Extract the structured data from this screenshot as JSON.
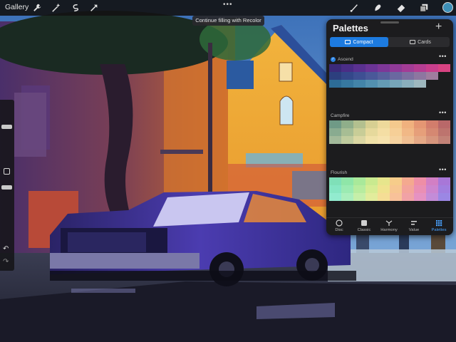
{
  "topbar": {
    "gallery_label": "Gallery",
    "more_label": "•••",
    "icons": [
      "wrench-icon",
      "magic-wand-icon",
      "selection-icon",
      "transform-arrow-icon",
      "brush-icon",
      "smudge-icon",
      "eraser-icon",
      "layers-icon"
    ],
    "current_color": "#3d8fb7"
  },
  "toast": {
    "text": "Continue filling with Recolor"
  },
  "sidebar": {
    "undo_label": "↶",
    "redo_label": "↷"
  },
  "palettes": {
    "title": "Palettes",
    "add_label": "+",
    "view_modes": [
      {
        "label": "Compact",
        "active": true
      },
      {
        "label": "Cards",
        "active": false
      }
    ],
    "items": [
      {
        "name": "Ascend",
        "default": true,
        "more": "•••",
        "colors": [
          "#3b2a7a",
          "#4a2d86",
          "#5a3190",
          "#6b3496",
          "#7d3798",
          "#903a98",
          "#a33c96",
          "#b53d92",
          "#c83e8c",
          "#d84382",
          "#2c3f7e",
          "#34478a",
          "#3e4f93",
          "#4a5899",
          "#58609d",
          "#6a68a0",
          "#7c6fa1",
          "#8d76a0",
          "#9f7d9e",
          "#1c1c1e",
          "#2d6c97",
          "#3778a0",
          "#4384a9",
          "#5290b0",
          "#649bb5",
          "#77a5b9",
          "#8aaebc",
          "#9eb7be",
          "#1c1c1e",
          "#1c1c1e"
        ]
      },
      {
        "name": "Campfire",
        "default": false,
        "more": "•••",
        "colors": [
          "#6f9a86",
          "#8fae8a",
          "#b3c08f",
          "#d7cf92",
          "#edd99b",
          "#f4c98d",
          "#f0b17e",
          "#e49673",
          "#d27d6c",
          "#b96869",
          "#89ab90",
          "#a7bd94",
          "#c8cd97",
          "#e6d99c",
          "#f4dea4",
          "#f6cf97",
          "#f1b886",
          "#e69f7a",
          "#d58872",
          "#bd746e",
          "#a2b99a",
          "#bfcb9e",
          "#dbd7a3",
          "#f0e1a8",
          "#f6e2ad",
          "#f6d3a0",
          "#f0bf92",
          "#e5a986",
          "#d6957d",
          "#c28277"
        ]
      },
      {
        "name": "Flourish",
        "default": false,
        "more": "•••",
        "colors": [
          "#7fe0b8",
          "#8fe6a8",
          "#a9e99a",
          "#c9ea8f",
          "#e7e58c",
          "#f6cc8a",
          "#f4a98f",
          "#ee8ea6",
          "#d27fc4",
          "#a877d8",
          "#86e6c4",
          "#9beab2",
          "#b7ec9f",
          "#d6ec94",
          "#f0e28f",
          "#f7c691",
          "#f3a49b",
          "#ea8fb4",
          "#cc85cf",
          "#a17fdf",
          "#92ebcf",
          "#aaeebd",
          "#c6efa9",
          "#e2ec9c",
          "#f5dd95",
          "#f8c199",
          "#f1a2a6",
          "#e692c2",
          "#c38cd8",
          "#9b87e4"
        ]
      }
    ],
    "tabs": [
      {
        "label": "Disc",
        "icon": "disc-icon",
        "active": false
      },
      {
        "label": "Classic",
        "icon": "classic-square-icon",
        "active": false
      },
      {
        "label": "Harmony",
        "icon": "harmony-icon",
        "active": false
      },
      {
        "label": "Value",
        "icon": "value-sliders-icon",
        "active": false
      },
      {
        "label": "Palettes",
        "icon": "palettes-grid-icon",
        "active": true
      }
    ]
  }
}
